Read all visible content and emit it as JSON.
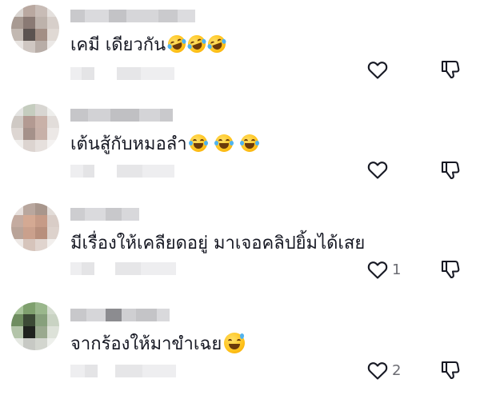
{
  "comments": [
    {
      "text": "เคมี เดียวกัน",
      "emoji_names": [
        "rofl-emoji",
        "rofl-emoji",
        "rofl-emoji"
      ],
      "like_count": ""
    },
    {
      "text": "เต้นสู้กับหมอลำ",
      "emoji_names": [
        "laughing-tears-emoji",
        "laughing-tears-emoji",
        "laughing-tears-emoji"
      ],
      "like_count": ""
    },
    {
      "text": "มีเรื่องให้เคลียดอยู่ มาเจอคลิปยิ้มได้เสย",
      "emoji_names": [],
      "like_count": "1"
    },
    {
      "text": "จากร้องให้มาขำเฉย",
      "emoji_names": [
        "grinning-sweat-emoji"
      ],
      "like_count": "2"
    }
  ],
  "icons": {
    "like": "heart-outline-icon",
    "dislike": "thumbs-down-outline-icon"
  },
  "colors": {
    "text": "#161823",
    "icon": "#161823",
    "count": "#6b6c73"
  }
}
